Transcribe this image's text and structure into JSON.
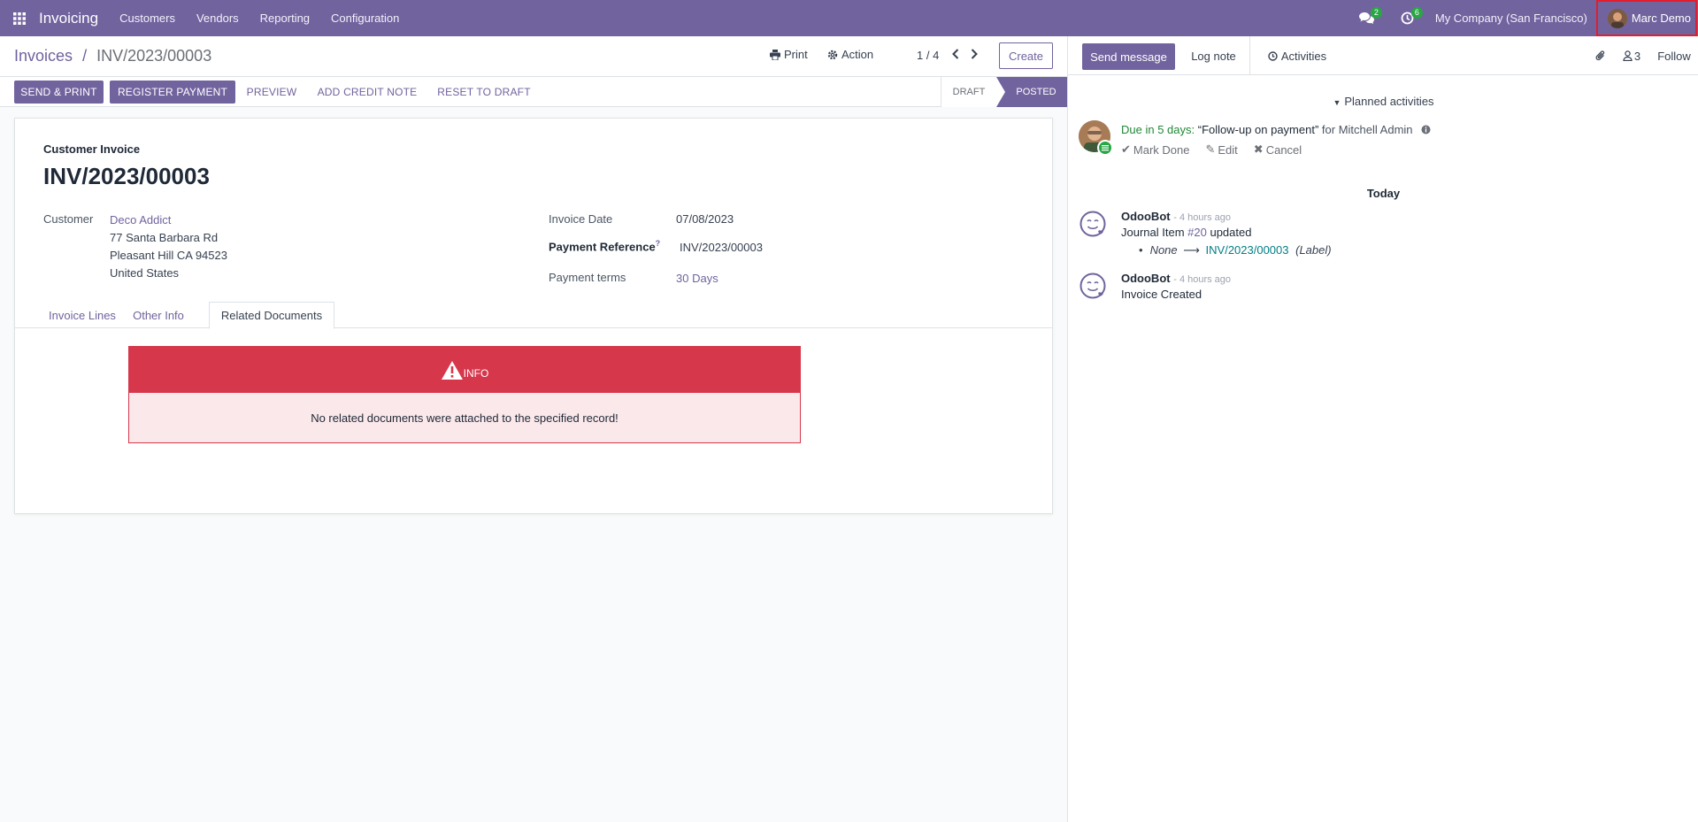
{
  "navbar": {
    "brand": "Invoicing",
    "menu": [
      "Customers",
      "Vendors",
      "Reporting",
      "Configuration"
    ],
    "messages_count": "2",
    "activities_count": "6",
    "company": "My Company (San Francisco)",
    "user": "Marc Demo"
  },
  "control_panel": {
    "breadcrumb_parent": "Invoices",
    "breadcrumb_separator": "/",
    "breadcrumb_current": "INV/2023/00003",
    "print_label": "Print",
    "action_label": "Action",
    "pager": "1 / 4",
    "create_label": "Create"
  },
  "statusbar": {
    "buttons": [
      "SEND & PRINT",
      "REGISTER PAYMENT",
      "PREVIEW",
      "ADD CREDIT NOTE",
      "RESET TO DRAFT"
    ],
    "stages": [
      "DRAFT",
      "POSTED"
    ],
    "current_stage": "POSTED"
  },
  "form": {
    "subtitle": "Customer Invoice",
    "title": "INV/2023/00003",
    "customer_label": "Customer",
    "customer_name": "Deco Addict",
    "address_line1": "77 Santa Barbara Rd",
    "address_line2": "Pleasant Hill CA 94523",
    "address_line3": "United States",
    "invoice_date_label": "Invoice Date",
    "invoice_date": "07/08/2023",
    "payment_reference_label": "Payment Reference",
    "payment_reference_help": "?",
    "payment_reference": "INV/2023/00003",
    "payment_terms_label": "Payment terms",
    "payment_terms": "30 Days",
    "tabs": [
      "Invoice Lines",
      "Other Info",
      "Related Documents"
    ],
    "active_tab": "Related Documents",
    "alert_title": "INFO",
    "alert_message": "No related documents were attached to the specified record!"
  },
  "chatter": {
    "send_message": "Send message",
    "log_note": "Log note",
    "activities": "Activities",
    "followers_count": "3",
    "follow": "Follow",
    "planned_activities": "Planned activities",
    "activity_due": "Due in 5 days:",
    "activity_summary": "“Follow-up on payment”",
    "activity_for": "for Mitchell Admin",
    "mark_done": "Mark Done",
    "edit": "Edit",
    "cancel": "Cancel",
    "date_separator": "Today",
    "messages": [
      {
        "author": "OdooBot",
        "date": "- 4 hours ago",
        "body_prefix": "Journal Item ",
        "body_link": "#20",
        "body_suffix": " updated",
        "tracking_old": "None",
        "tracking_new": "INV/2023/00003",
        "tracking_field": "(Label)"
      },
      {
        "author": "OdooBot",
        "date": "- 4 hours ago",
        "body": "Invoice Created"
      }
    ]
  },
  "colors": {
    "brand": "#71639e",
    "danger": "#d6374b",
    "success": "#28a745"
  }
}
